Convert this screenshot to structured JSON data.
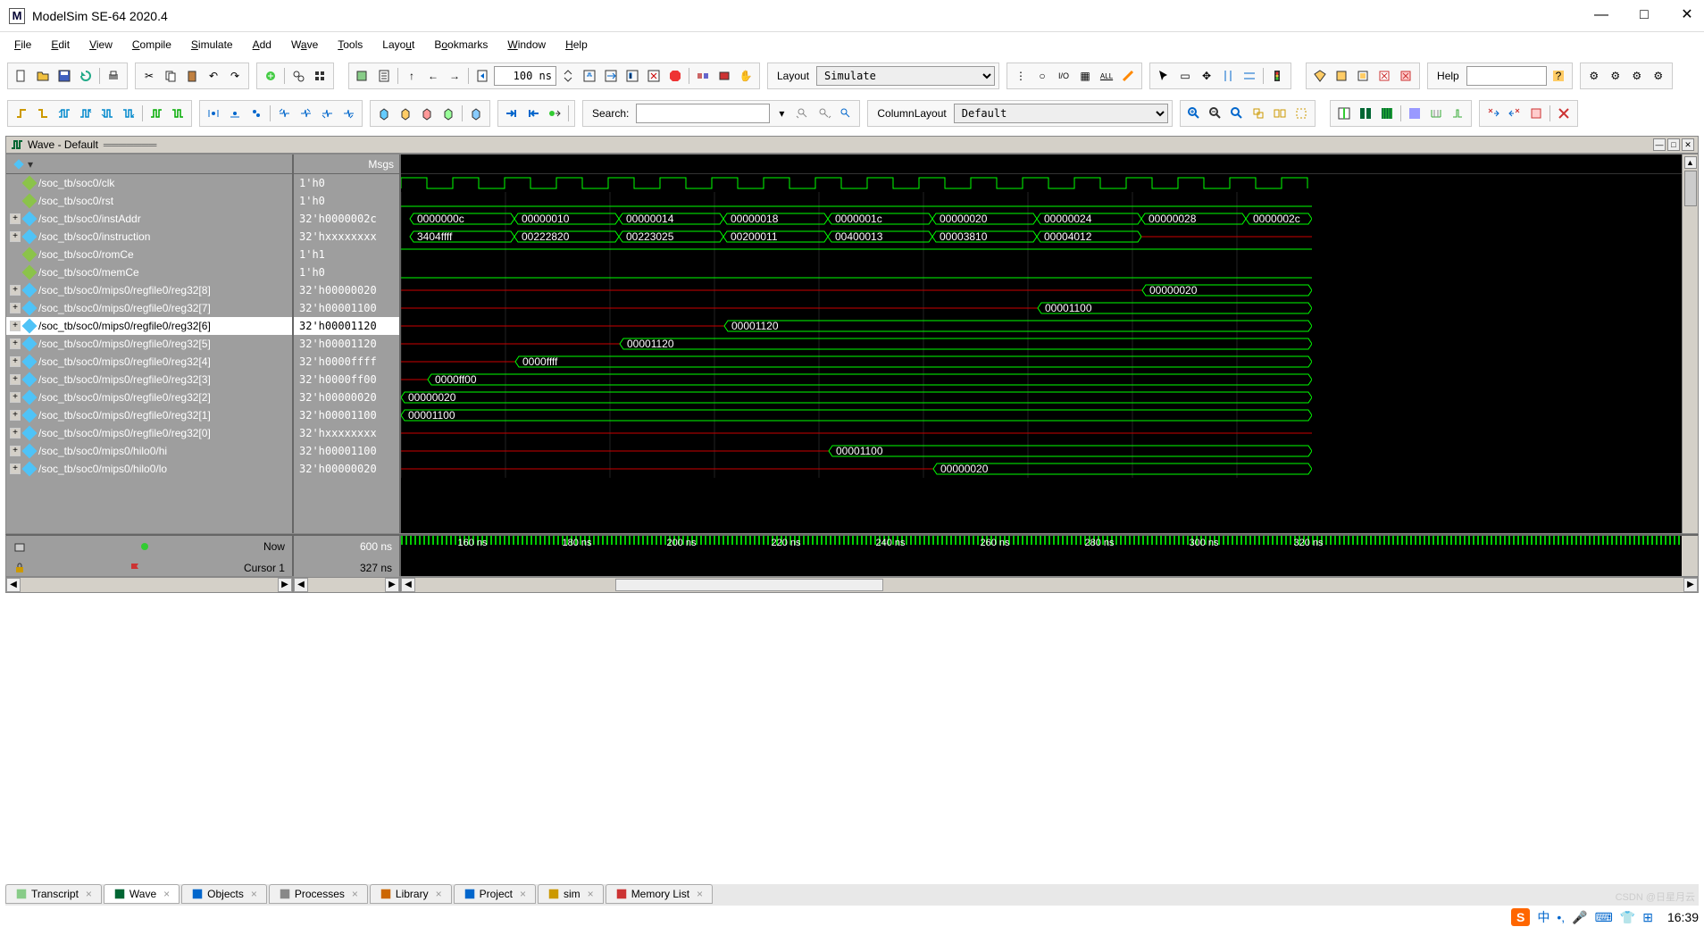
{
  "title": "ModelSim SE-64 2020.4",
  "menu": [
    "File",
    "Edit",
    "View",
    "Compile",
    "Simulate",
    "Add",
    "Wave",
    "Tools",
    "Layout",
    "Bookmarks",
    "Window",
    "Help"
  ],
  "layout_label": "Layout",
  "layout_value": "Simulate",
  "help_label": "Help",
  "search_label": "Search:",
  "column_layout_label": "ColumnLayout",
  "column_layout_value": "Default",
  "run_time": "100 ns",
  "wave_title": "Wave - Default",
  "msgs_header": "Msgs",
  "signals": [
    {
      "exp": "",
      "name": "/soc_tb/soc0/clk",
      "msg": "1'h0",
      "sel": false,
      "leaf": true
    },
    {
      "exp": "",
      "name": "/soc_tb/soc0/rst",
      "msg": "1'h0",
      "sel": false,
      "leaf": true
    },
    {
      "exp": "+",
      "name": "/soc_tb/soc0/instAddr",
      "msg": "32'h0000002c",
      "sel": false
    },
    {
      "exp": "+",
      "name": "/soc_tb/soc0/instruction",
      "msg": "32'hxxxxxxxx",
      "sel": false
    },
    {
      "exp": "",
      "name": "/soc_tb/soc0/romCe",
      "msg": "1'h1",
      "sel": false,
      "leaf": true
    },
    {
      "exp": "",
      "name": "/soc_tb/soc0/memCe",
      "msg": "1'h0",
      "sel": false,
      "leaf": true
    },
    {
      "exp": "+",
      "name": "/soc_tb/soc0/mips0/regfile0/reg32[8]",
      "msg": "32'h00000020",
      "sel": false
    },
    {
      "exp": "+",
      "name": "/soc_tb/soc0/mips0/regfile0/reg32[7]",
      "msg": "32'h00001100",
      "sel": false
    },
    {
      "exp": "+",
      "name": "/soc_tb/soc0/mips0/regfile0/reg32[6]",
      "msg": "32'h00001120",
      "sel": true
    },
    {
      "exp": "+",
      "name": "/soc_tb/soc0/mips0/regfile0/reg32[5]",
      "msg": "32'h00001120",
      "sel": false
    },
    {
      "exp": "+",
      "name": "/soc_tb/soc0/mips0/regfile0/reg32[4]",
      "msg": "32'h0000ffff",
      "sel": false
    },
    {
      "exp": "+",
      "name": "/soc_tb/soc0/mips0/regfile0/reg32[3]",
      "msg": "32'h0000ff00",
      "sel": false
    },
    {
      "exp": "+",
      "name": "/soc_tb/soc0/mips0/regfile0/reg32[2]",
      "msg": "32'h00000020",
      "sel": false
    },
    {
      "exp": "+",
      "name": "/soc_tb/soc0/mips0/regfile0/reg32[1]",
      "msg": "32'h00001100",
      "sel": false
    },
    {
      "exp": "+",
      "name": "/soc_tb/soc0/mips0/regfile0/reg32[0]",
      "msg": "32'hxxxxxxxx",
      "sel": false
    },
    {
      "exp": "+",
      "name": "/soc_tb/soc0/mips0/hilo0/hi",
      "msg": "32'h00001100",
      "sel": false
    },
    {
      "exp": "+",
      "name": "/soc_tb/soc0/mips0/hilo0/lo",
      "msg": "32'h00000020",
      "sel": false
    }
  ],
  "now_label": "Now",
  "now_value": "600 ns",
  "cursor_label": "Cursor 1",
  "cursor_value": "327 ns",
  "time_ticks": [
    "160 ns",
    "180 ns",
    "200 ns",
    "220 ns",
    "240 ns",
    "260 ns",
    "280 ns",
    "300 ns",
    "320 ns"
  ],
  "bus_values": {
    "instAddr": [
      "0000000c",
      "00000010",
      "00000014",
      "00000018",
      "0000001c",
      "00000020",
      "00000024",
      "00000028",
      "0000002c"
    ],
    "instruction": [
      "3404ffff",
      "00222820",
      "00223025",
      "00200011",
      "00400013",
      "00003810",
      "00004012"
    ],
    "reg8": "00000020",
    "reg7": "00001100",
    "reg6": "00001120",
    "reg5": "00001120",
    "reg4": "0000ffff",
    "reg3": "0000ff00",
    "reg2": "00000020",
    "reg1": "00001100",
    "hi": "00001100",
    "lo": "00000020"
  },
  "tabs": [
    {
      "label": "Transcript",
      "icon": "transcript"
    },
    {
      "label": "Wave",
      "icon": "wave",
      "active": true
    },
    {
      "label": "Objects",
      "icon": "objects"
    },
    {
      "label": "Processes",
      "icon": "processes"
    },
    {
      "label": "Library",
      "icon": "library"
    },
    {
      "label": "Project",
      "icon": "project"
    },
    {
      "label": "sim",
      "icon": "sim"
    },
    {
      "label": "Memory List",
      "icon": "memory"
    }
  ],
  "watermark": "CSDN @日星月云",
  "clock": "16:39"
}
